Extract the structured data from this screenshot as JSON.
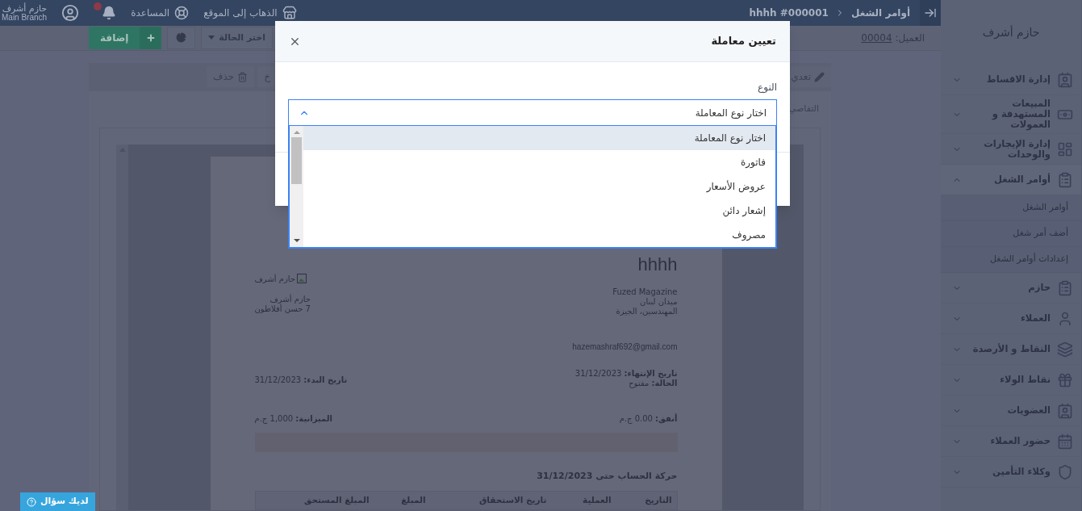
{
  "topbar": {
    "breadcrumb": [
      "أوامر الشغل",
      "hhhh #000001"
    ],
    "links": [
      {
        "label": "الذهاب إلى الموقع"
      },
      {
        "label": "المساعدة"
      }
    ],
    "notifications": {
      "unread": true
    },
    "user": {
      "name": "حازم أشرف",
      "branch": "Main Branch"
    }
  },
  "sidebar": {
    "user": "حازم أشرف",
    "items": [
      {
        "label": "إدارة الاقساط",
        "expanded": false
      },
      {
        "label": "المبيعات المستهدفة و العمولات",
        "expanded": false
      },
      {
        "label": "إدارة الإيجارات والوحدات",
        "expanded": false
      },
      {
        "label": "أوامر الشغل",
        "expanded": true,
        "children": [
          {
            "label": "أوامر الشغل"
          },
          {
            "label": "أضف أمر شغل"
          },
          {
            "label": "إعدادات أوامر الشغل"
          }
        ]
      },
      {
        "label": "حازم",
        "expanded": false
      },
      {
        "label": "العملاء",
        "expanded": false
      },
      {
        "label": "النقاط و الأرصدة",
        "expanded": false
      },
      {
        "label": "نقاط الولاء",
        "expanded": false
      },
      {
        "label": "العضويات",
        "expanded": false
      },
      {
        "label": "حضور العملاء",
        "expanded": false
      },
      {
        "label": "وكلاء التأمين",
        "expanded": false
      }
    ]
  },
  "toolbar": {
    "client_label": "العميل:",
    "client_link": "00004",
    "status_button": "اختر الحالة",
    "add_button": "إضافة"
  },
  "actions": [
    {
      "kind": "edit",
      "label": "تعدي"
    },
    {
      "kind": "other",
      "label": "خ"
    },
    {
      "kind": "delete",
      "label": "حذف"
    }
  ],
  "details_tab": "التفاصي",
  "document": {
    "title": "hhhh",
    "logo_alt": "حازم أشرف",
    "company": [
      "حازم أشرف",
      "7 حسن أفلاطون"
    ],
    "client": [
      "Fuzed Magazine",
      "ميدان لبنان",
      "المهندسين، الجيزة"
    ],
    "email": "hazemashraf692@gmail.com",
    "fields_right": [
      {
        "label": "تاريخ الإنتهاء:",
        "value": "31/12/2023"
      },
      {
        "label": "الحالة:",
        "value": "مفتوح"
      }
    ],
    "fields_left": [
      {
        "label": "تاريخ البدء:",
        "value": "31/12/2023"
      }
    ],
    "spent": {
      "label": "أنفق:",
      "value": "0.00 ج.م"
    },
    "budget": {
      "label": "الميزانية:",
      "value": "1,000 ج.م"
    },
    "progress": {
      "level": 0
    },
    "statement_title": "حركة الحساب حتى 31/12/2023",
    "columns": [
      "التاريخ",
      "العملية",
      "تاريخ الاستحقاق",
      "المبلغ",
      "المبلغ المستحق"
    ]
  },
  "modal": {
    "title": "تعيين معاملة",
    "field_label": "النوع",
    "select": {
      "value": "اختار نوع المعاملة",
      "expanded": true,
      "options": [
        {
          "label": "اختار نوع المعاملة",
          "selected": true
        },
        {
          "label": "فاتورة",
          "selected": false
        },
        {
          "label": "عروض الأسعار",
          "selected": false
        },
        {
          "label": "إشعار دائن",
          "selected": false
        },
        {
          "label": "مصروف",
          "selected": false
        }
      ]
    }
  },
  "help_button": "لديك سؤال"
}
